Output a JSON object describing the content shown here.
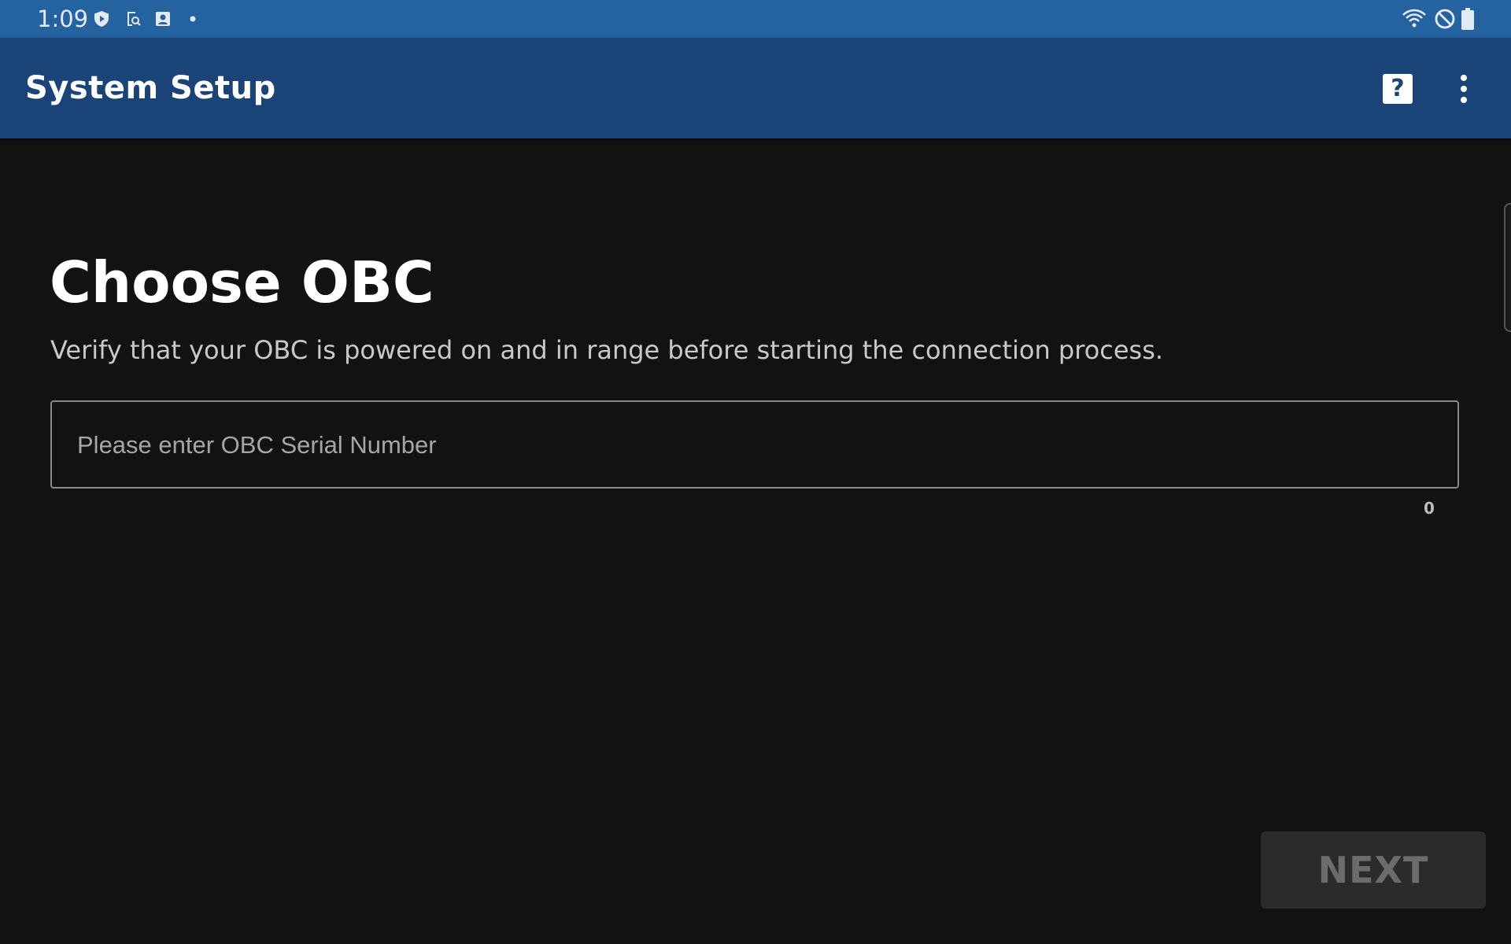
{
  "status_bar": {
    "time": "1:09",
    "left_icons": [
      "play-shield-icon",
      "screen-search-icon",
      "portrait-icon",
      "notification-dot-icon"
    ],
    "right_icons": [
      "wifi-icon",
      "do-not-disturb-icon",
      "battery-icon"
    ]
  },
  "app_bar": {
    "title": "System Setup",
    "help_label": "?",
    "overflow_icon": "more-vert-icon",
    "background_color": "#1a4478"
  },
  "main": {
    "heading": "Choose OBC",
    "description": "Verify that your OBC is powered on and in range before starting the connection process.",
    "serial_input": {
      "value": "",
      "placeholder": "Please enter OBC Serial Number"
    },
    "char_count": "0",
    "next_label": "NEXT",
    "next_enabled": false
  },
  "colors": {
    "status_bar": "#2562a0",
    "background": "#121212",
    "button_disabled": "#2b2b2b"
  }
}
